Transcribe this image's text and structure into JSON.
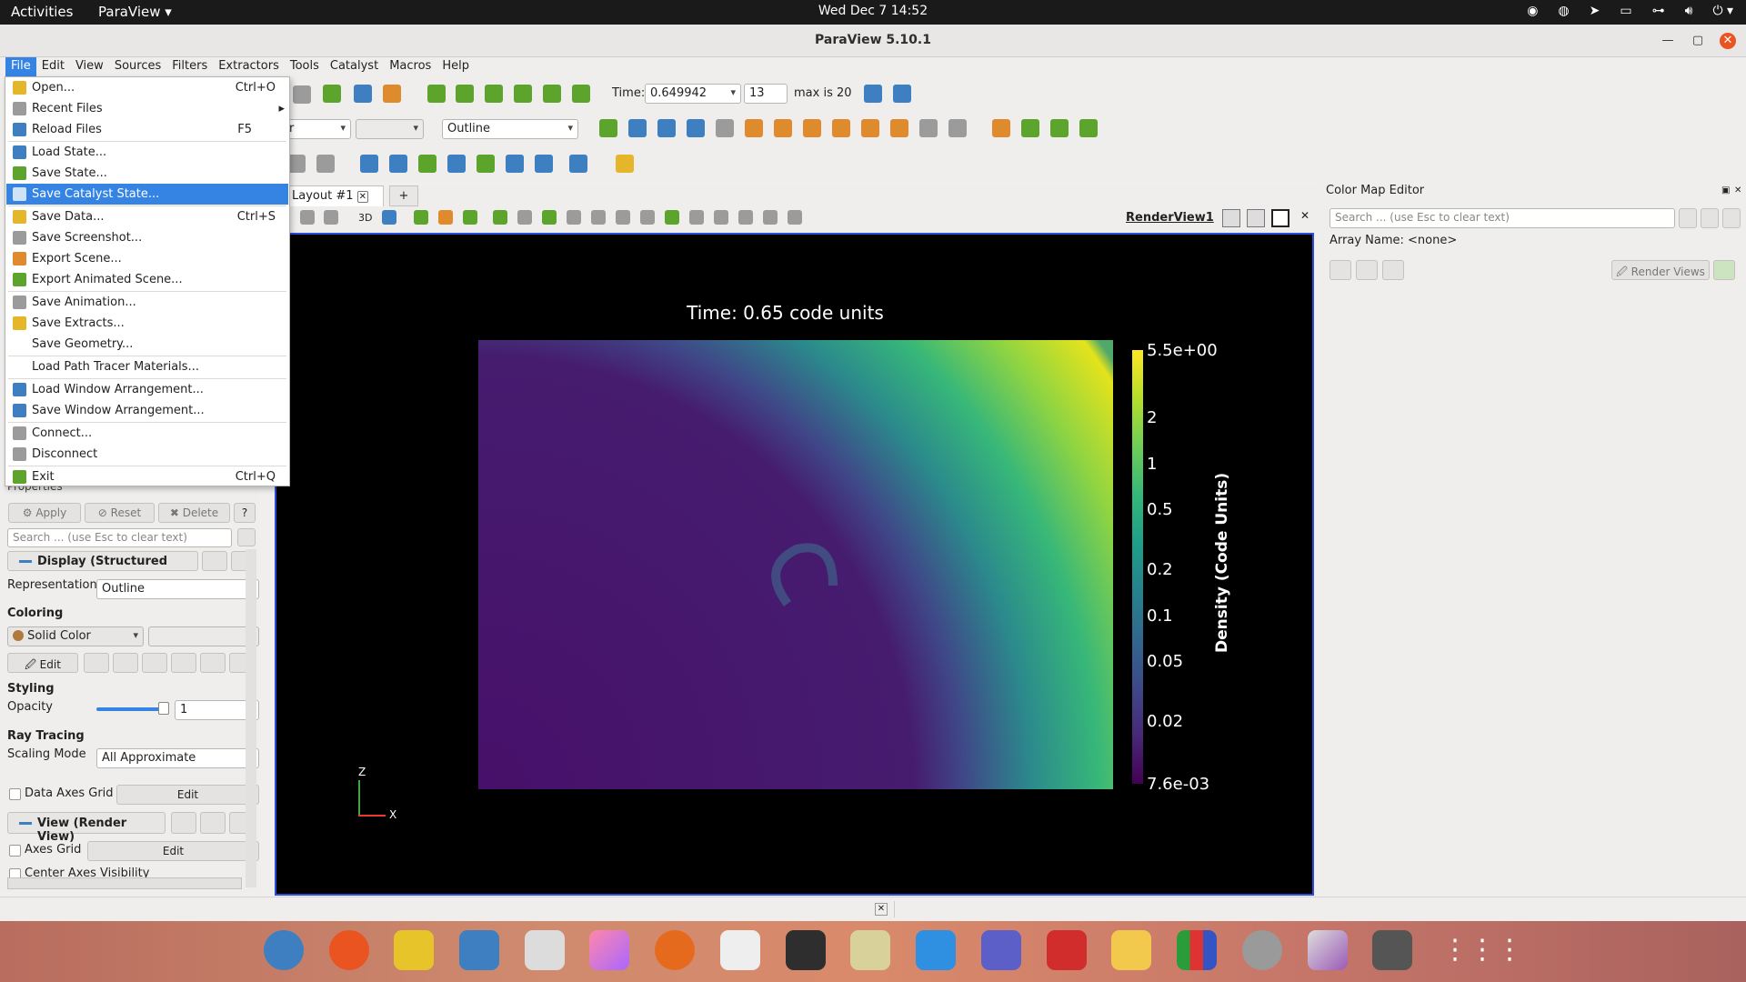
{
  "topbar": {
    "activities": "Activities",
    "app": "ParaView ▾",
    "clock": "Wed Dec 7  14:52"
  },
  "window": {
    "title": "ParaView 5.10.1"
  },
  "menubar": [
    "File",
    "Edit",
    "View",
    "Sources",
    "Filters",
    "Extractors",
    "Tools",
    "Catalyst",
    "Macros",
    "Help"
  ],
  "toolbar": {
    "time_label": "Time:",
    "time_value": "0.649942",
    "step_value": "13",
    "max_label": "max is 20",
    "representation": "Outline",
    "combo_left": "r"
  },
  "view": {
    "layout_tab": "Layout #1",
    "add_tab": "+",
    "view_name": "RenderView1",
    "toggle_3d": "3D"
  },
  "render": {
    "time_annotation": "Time: 0.65 code units",
    "colorbar_title": "Density (Code Units)",
    "colorbar_ticks": [
      "5.5e+00",
      "2",
      "1",
      "0.5",
      "0.2",
      "0.1",
      "0.05",
      "0.02",
      "7.6e-03"
    ],
    "axis_z": "Z",
    "axis_x": "X"
  },
  "filemenu": {
    "items": [
      {
        "label": "Open...",
        "shortcut": "Ctrl+O"
      },
      {
        "label": "Recent Files",
        "shortcut": ""
      },
      {
        "label": "Reload Files",
        "shortcut": "F5"
      },
      {
        "label": "Load State...",
        "shortcut": ""
      },
      {
        "label": "Save State...",
        "shortcut": ""
      },
      {
        "label": "Save Catalyst State...",
        "shortcut": ""
      },
      {
        "label": "Save Data...",
        "shortcut": "Ctrl+S"
      },
      {
        "label": "Save Screenshot...",
        "shortcut": ""
      },
      {
        "label": "Export Scene...",
        "shortcut": ""
      },
      {
        "label": "Export Animated Scene...",
        "shortcut": ""
      },
      {
        "label": "Save Animation...",
        "shortcut": ""
      },
      {
        "label": "Save Extracts...",
        "shortcut": ""
      },
      {
        "label": "Save Geometry...",
        "shortcut": ""
      },
      {
        "label": "Load Path Tracer Materials...",
        "shortcut": ""
      },
      {
        "label": "Load Window Arrangement...",
        "shortcut": ""
      },
      {
        "label": "Save Window Arrangement...",
        "shortcut": ""
      },
      {
        "label": "Connect...",
        "shortcut": ""
      },
      {
        "label": "Disconnect",
        "shortcut": ""
      },
      {
        "label": "Exit",
        "shortcut": "Ctrl+Q"
      }
    ]
  },
  "properties": {
    "header": "Properties",
    "apply": "Apply",
    "reset": "Reset",
    "delete": "Delete",
    "help": "?",
    "search_placeholder": "Search ... (use Esc to clear text)",
    "display_section": "Display (Structured",
    "representation_label": "Representation",
    "representation_value": "Outline",
    "coloring_label": "Coloring",
    "coloring_value": "Solid Color",
    "edit": "Edit",
    "styling_label": "Styling",
    "opacity_label": "Opacity",
    "opacity_value": "1",
    "opacity_level": 1.0,
    "raytracing_label": "Ray Tracing",
    "scaling_label": "Scaling Mode",
    "scaling_value": "All Approximate",
    "data_axes_grid": "Data Axes Grid",
    "view_section": "View (Render View)",
    "axes_grid": "Axes Grid",
    "center_axes": "Center Axes Visibility"
  },
  "colormap": {
    "title": "Color Map Editor",
    "search_placeholder": "Search ... (use Esc to clear text)",
    "array_name": "Array Name: <none>",
    "render_views": "Render Views"
  }
}
